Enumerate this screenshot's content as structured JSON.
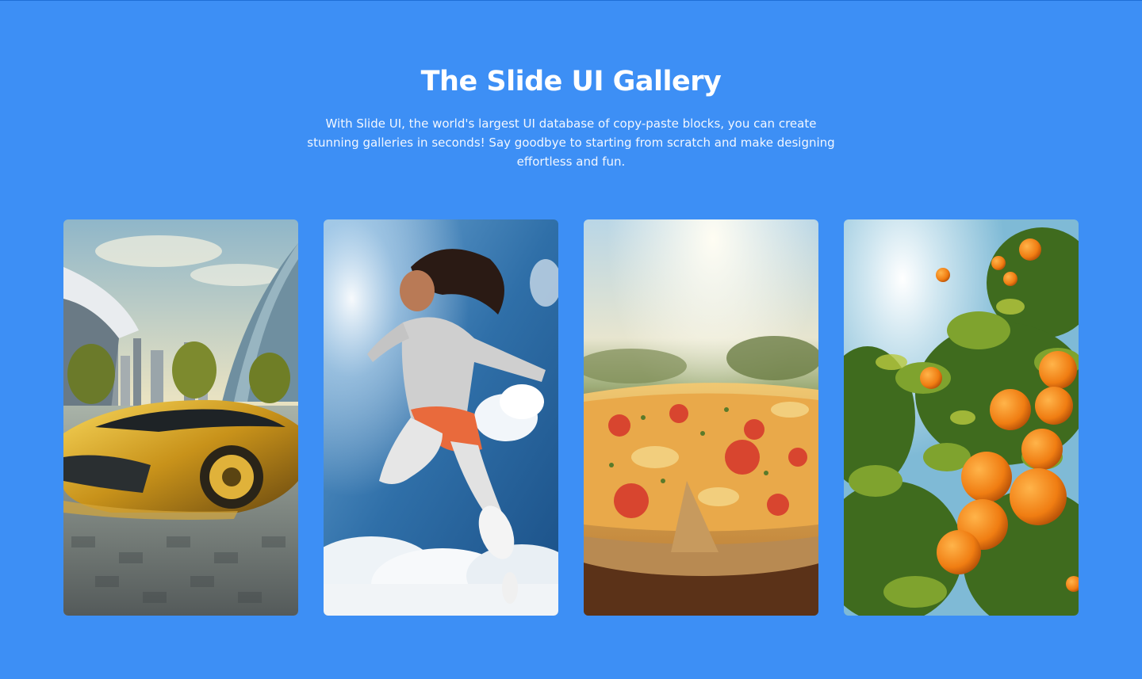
{
  "page": {
    "title": "The Slide UI Gallery",
    "description": "With Slide UI, the world's largest UI database of copy-paste blocks, you can create stunning galleries in seconds! Say goodbye to starting from scratch and make designing effortless and fun."
  },
  "colors": {
    "background": "#3d8ff5",
    "text": "#ffffff"
  },
  "gallery": {
    "items": [
      {
        "subject": "golden futuristic sports car in city"
      },
      {
        "subject": "woman jumping against blue sky"
      },
      {
        "subject": "pizza with melted cheese in sunlight"
      },
      {
        "subject": "orange tree with ripe oranges"
      }
    ]
  }
}
